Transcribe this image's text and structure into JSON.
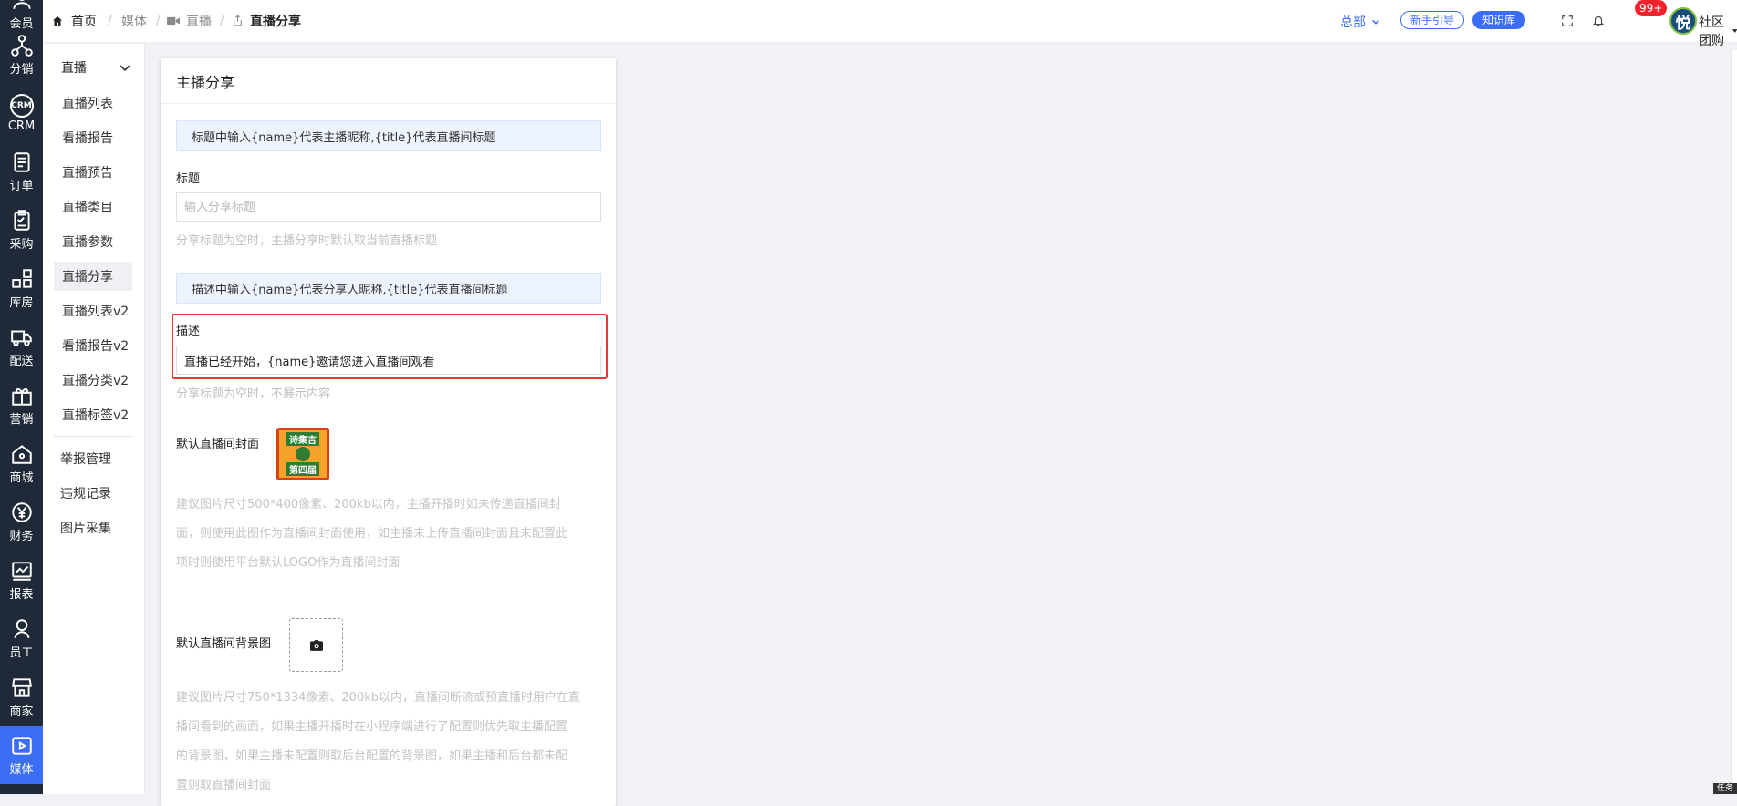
{
  "app": {
    "left_nav": [
      {
        "label": "会员",
        "icon": "member-icon"
      },
      {
        "label": "分销",
        "icon": "distribution-icon"
      },
      {
        "label": "CRM",
        "icon": "crm-icon"
      },
      {
        "label": "订单",
        "icon": "order-icon"
      },
      {
        "label": "采购",
        "icon": "purchase-icon"
      },
      {
        "label": "库房",
        "icon": "warehouse-icon"
      },
      {
        "label": "配送",
        "icon": "delivery-icon"
      },
      {
        "label": "营销",
        "icon": "gift-icon"
      },
      {
        "label": "商城",
        "icon": "mall-icon"
      },
      {
        "label": "财务",
        "icon": "finance-icon"
      },
      {
        "label": "报表",
        "icon": "report-icon"
      },
      {
        "label": "员工",
        "icon": "staff-icon"
      },
      {
        "label": "商家",
        "icon": "store-icon"
      },
      {
        "label": "媒体",
        "icon": "media-icon"
      }
    ],
    "accent": "#3b6ef5"
  },
  "breadcrumb": {
    "home": "首页",
    "media": "媒体",
    "live": "直播",
    "current": "直播分享",
    "separator": "/"
  },
  "header": {
    "org": "总部",
    "guide": "新手引导",
    "knowledge": "知识库",
    "notifications_badge": "99+",
    "avatar_text": "悦",
    "user": "社区团购"
  },
  "subnav": {
    "group": "直播",
    "items": [
      "直播列表",
      "看播报告",
      "直播预告",
      "直播类目",
      "直播参数",
      "直播分享",
      "直播列表v2",
      "看播报告v2",
      "直播分类v2",
      "直播标签v2"
    ],
    "active": "直播分享",
    "extra_items": [
      "举报管理",
      "违规记录",
      "图片采集"
    ]
  },
  "form": {
    "title": "主播分享",
    "title_tip": "标题中输入{name}代表主播昵称,{title}代表直播间标题",
    "title_label": "标题",
    "title_placeholder": "输入分享标题",
    "title_hint": "分享标题为空时，主播分享时默认取当前直播标题",
    "desc_tip": "描述中输入{name}代表分享人昵称,{title}代表直播间标题",
    "desc_label": "描述",
    "desc_value": "直播已经开始，{name}邀请您进入直播间观看",
    "desc_hint": "分享标题为空时，不展示内容",
    "cover_label": "默认直播间封面",
    "cover_badge_top": "诗集吉",
    "cover_badge_bottom": "第四届",
    "cover_hint_lines": [
      "建议图片尺寸500*400像素、200kb以内，主播开播时如未传递直播间封",
      "面，则使用此图作为直播间封面使用，如主播未上传直播间封面且未配置此",
      "项时则使用平台默认LOGO作为直播间封面"
    ],
    "bg_label": "默认直播间背景图",
    "bg_hint_lines": [
      "建议图片尺寸750*1334像素、200kb以内，直播间断流或预直播时用户在直",
      "播间看到的画面，如果主播开播时在小程序端进行了配置则优先取主播配置",
      "的背景图，如果主播未配置则取后台配置的背景图，如果主播和后台都未配",
      "置则取直播间封面"
    ]
  },
  "corner_tag": "任务"
}
